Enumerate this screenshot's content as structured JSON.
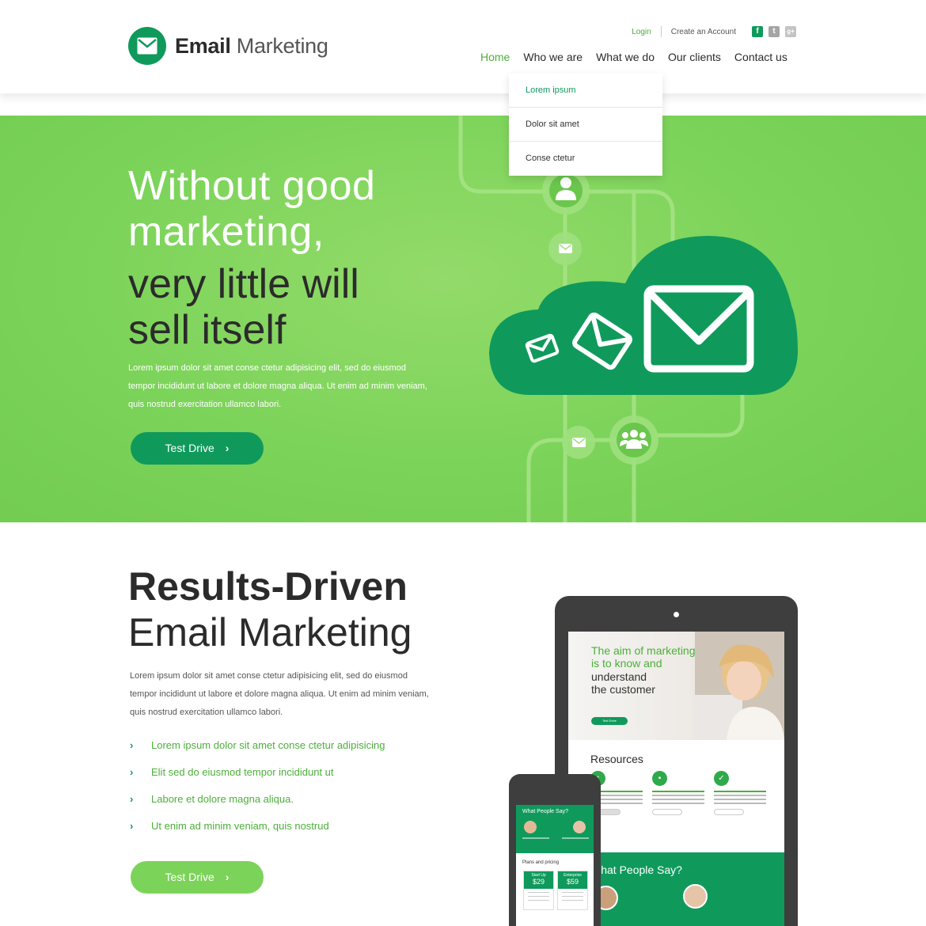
{
  "brand": {
    "name_bold": "Email",
    "name_light": "Marketing"
  },
  "toplinks": {
    "login": "Login",
    "create_account": "Create an Account"
  },
  "social": {
    "facebook": "f",
    "twitter": "t",
    "google": "g+"
  },
  "nav": [
    "Home",
    "Who we are",
    "What we do",
    "Our clients",
    "Contact us"
  ],
  "dropdown": [
    "Lorem ipsum",
    "Dolor sit amet",
    "Conse ctetur"
  ],
  "hero": {
    "title_white_1": "Without good",
    "title_white_2": "marketing,",
    "title_dark_1": "very little will",
    "title_dark_2": "sell itself",
    "description": "Lorem ipsum dolor sit amet conse ctetur adipisicing elit, sed do eiusmod tempor incididunt ut labore et dolore magna aliqua. Ut enim ad minim veniam, quis nostrud exercitation ullamco labori.",
    "button": "Test Drive"
  },
  "section2": {
    "title_bold": "Results-Driven",
    "title_light": "Email Marketing",
    "description": "Lorem ipsum dolor sit amet conse ctetur adipisicing elit, sed do eiusmod tempor incididunt ut labore et dolore magna aliqua. Ut enim ad minim veniam, quis nostrud exercitation ullamco labori.",
    "list": [
      "Lorem ipsum dolor sit amet conse ctetur adipisicing",
      "Elit sed do eiusmod tempor incididunt ut",
      "Labore et dolore magna aliqua.",
      "Ut enim ad minim veniam, quis nostrud"
    ],
    "button": "Test Drive"
  },
  "tablet": {
    "hero_line1": "The aim of marketing",
    "hero_line2": "is to know and",
    "hero_line3": "understand",
    "hero_line4": "the customer",
    "hero_button": "Test Drive",
    "resources_title": "Resources",
    "testimonial_title": "What People Say?"
  },
  "phone": {
    "testimonial_title": "What People Say?",
    "plans_title": "Plans and pricing",
    "plan1_name": "Start Up",
    "plan1_price": "$29",
    "plan2_name": "Enterprise",
    "plan2_price": "$59"
  },
  "colors": {
    "brand_green": "#0f9a5c",
    "light_green": "#7bd359",
    "accent_text": "#4caf3a",
    "dark_text": "#2b2b2b"
  },
  "icons": {
    "logo": "envelope-icon",
    "list_bullet": "chevron-right-icon",
    "button_arrow": "chevron-right-icon"
  }
}
